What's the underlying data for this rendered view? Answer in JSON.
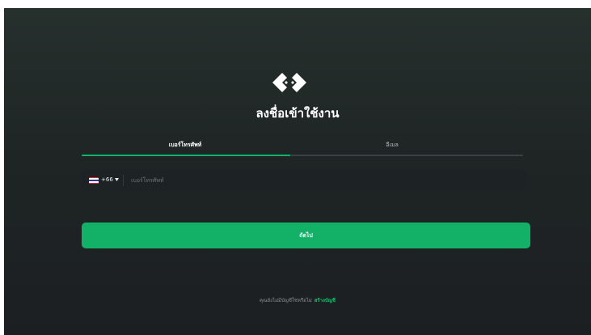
{
  "colors": {
    "accent": "#13b068",
    "background": "#1f2525",
    "link": "#17c06f"
  },
  "logo": {
    "icon": "brand-logo-icon"
  },
  "title": "ลงชื่อเข้าใช้งาน",
  "tabs": [
    {
      "label": "เบอร์โทรศัพท์",
      "active": true
    },
    {
      "label": "อีเมล",
      "active": false
    }
  ],
  "phone": {
    "country_flag": "thailand-flag-icon",
    "country_code": "+66",
    "dropdown_icon": "chevron-down-icon",
    "placeholder": "เบอร์โทรศัพท์",
    "value": ""
  },
  "next_button": {
    "label": "ถัดไป"
  },
  "signup": {
    "prompt": "คุณยังไม่มีบัญชีใช่หรือไม่",
    "link": "สร้างบัญชี"
  }
}
